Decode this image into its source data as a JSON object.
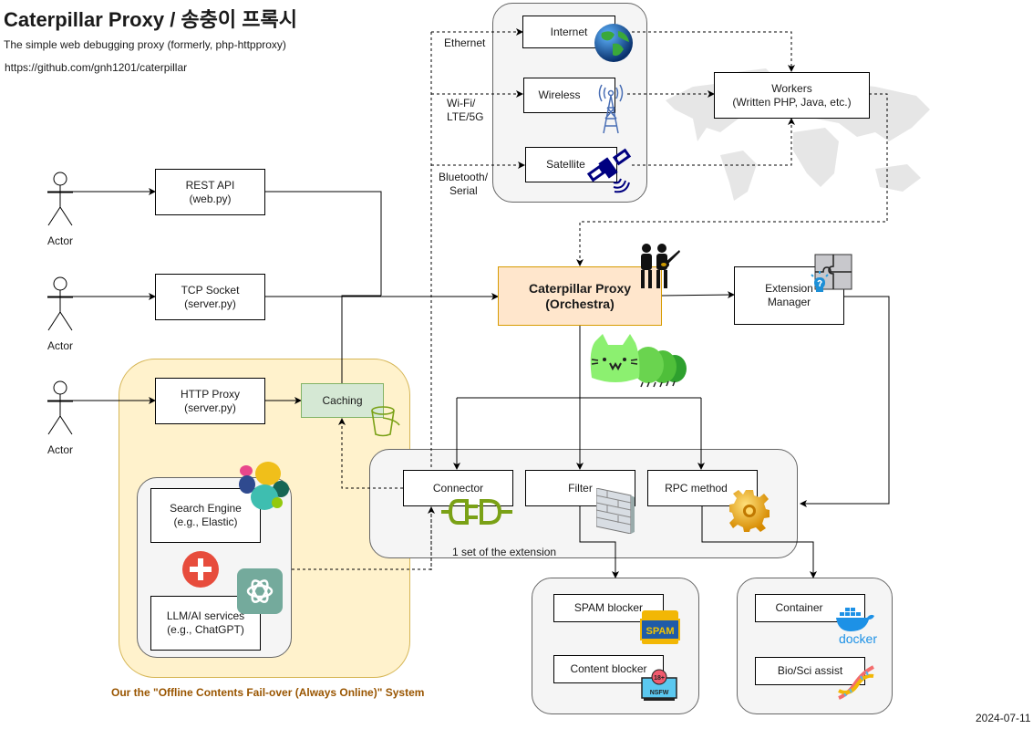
{
  "header": {
    "title": "Caterpillar Proxy / 송충이 프록시",
    "subtitle": "The simple web debugging proxy (formerly, php-httpproxy)",
    "url": "https://github.com/gnh1201/caterpillar"
  },
  "date": "2024-07-11",
  "actors": [
    {
      "label": "Actor"
    },
    {
      "label": "Actor"
    },
    {
      "label": "Actor"
    }
  ],
  "entrypoints": [
    {
      "line1": "REST API",
      "line2": "(web.py)"
    },
    {
      "line1": "TCP Socket",
      "line2": "(server.py)"
    },
    {
      "line1": "HTTP Proxy",
      "line2": "(server.py)"
    }
  ],
  "caching": {
    "label": "Caching"
  },
  "network": {
    "links": [
      {
        "medium": "Ethernet",
        "target": "Internet"
      },
      {
        "medium": "Wi-Fi/\nLTE/5G",
        "medium_line1": "Wi-Fi/",
        "medium_line2": "LTE/5G",
        "target": "Wireless"
      },
      {
        "medium_line1": "Bluetooth/",
        "medium_line2": "Serial",
        "target": "Satellite"
      }
    ]
  },
  "workers": {
    "line1": "Workers",
    "line2": "(Written PHP, Java, etc.)"
  },
  "orchestra": {
    "line1": "Caterpillar Proxy",
    "line2": "(Orchestra)"
  },
  "extension_manager": {
    "line1": "Extension",
    "line2": "Manager"
  },
  "extension_set": {
    "caption": "1 set of the extension",
    "items": [
      {
        "label": "Connector"
      },
      {
        "label": "Filter"
      },
      {
        "label": "RPC method"
      }
    ]
  },
  "offline_system": {
    "caption": "Our the \"Offline Contents Fail-over (Always Online)\" System",
    "search": {
      "line1": "Search Engine",
      "line2": "(e.g., Elastic)"
    },
    "llm": {
      "line1": "LLM/AI services",
      "line2": "(e.g., ChatGPT)"
    }
  },
  "filter_group": {
    "items": [
      {
        "label": "SPAM blocker"
      },
      {
        "label": "Content blocker"
      }
    ]
  },
  "rpc_group": {
    "items": [
      {
        "label": "Container"
      },
      {
        "label": "Bio/Sci assist"
      }
    ]
  },
  "icon_text": {
    "spam": "SPAM",
    "nsfw": "NSFW",
    "eighteen": "18+",
    "docker": "docker"
  }
}
